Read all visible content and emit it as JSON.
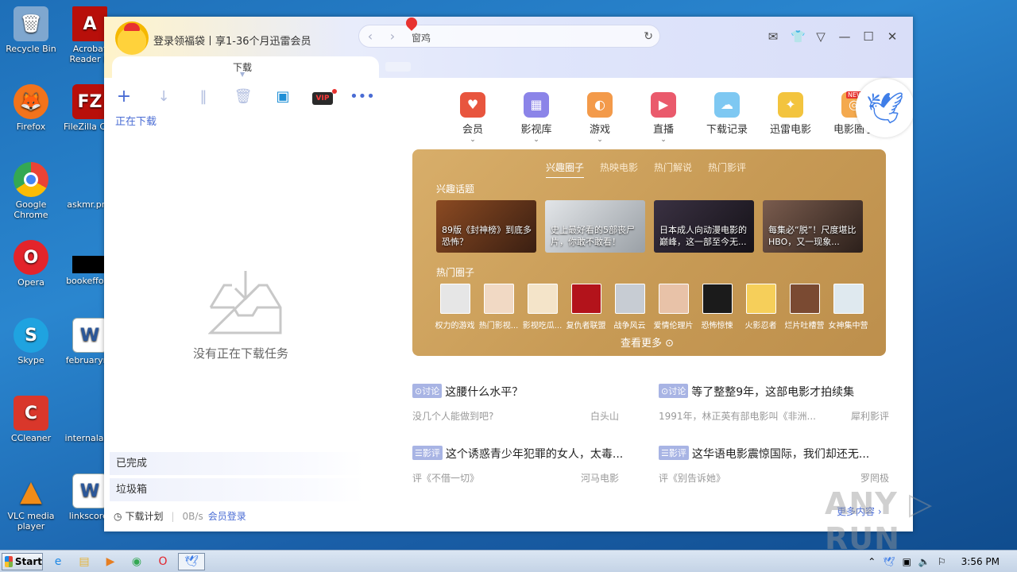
{
  "desktop": {
    "icons": [
      {
        "label": "Recycle Bin",
        "glyph": "🗑",
        "color": "#7fa7cf"
      },
      {
        "label": "Firefox",
        "glyph": "🦊",
        "color": "#f2731b"
      },
      {
        "label": "Google Chrome",
        "glyph": "◉",
        "color": "#34a853"
      },
      {
        "label": "Opera",
        "glyph": "O",
        "color": "#e3242b"
      },
      {
        "label": "Skype",
        "glyph": "S",
        "color": "#1fa3e0"
      },
      {
        "label": "CCleaner",
        "glyph": "C",
        "color": "#d9372b"
      },
      {
        "label": "VLC media player",
        "glyph": "▲",
        "color": "#f28c18"
      }
    ],
    "icons_col2": [
      {
        "label": "Acrobat Reader D",
        "glyph": "A",
        "color": "#b80f0a"
      },
      {
        "label": "FileZilla Clie",
        "glyph": "FZ",
        "color": "#b80f0a"
      },
      {
        "label": "askmr.png",
        "glyph": "",
        "color": "transparent"
      },
      {
        "label": "bookeffort.",
        "glyph": "",
        "color": "#000000"
      },
      {
        "label": "februaryna",
        "glyph": "W",
        "color": "#2b579a"
      },
      {
        "label": "internalang",
        "glyph": "",
        "color": "transparent"
      },
      {
        "label": "linkscore.",
        "glyph": "W",
        "color": "#2b579a"
      }
    ]
  },
  "taskbar": {
    "start_label": "Start",
    "clock": "3:56 PM"
  },
  "app": {
    "login_text": "登录领福袋丨享1-36个月迅雷会员",
    "url_text": "窗鸡",
    "tab_label": "下载",
    "downloading_label": "正在下载",
    "vip_label": "VIP",
    "empty_text": "没有正在下载任务",
    "side_completed": "已完成",
    "side_trash": "垃圾箱",
    "footer_plan": "下载计划",
    "footer_speed": "0B/s",
    "footer_member": "会员登录"
  },
  "categories": [
    {
      "label": "会员",
      "glyph": "♥",
      "color": "#e8553e",
      "caret": "⌄"
    },
    {
      "label": "影视库",
      "glyph": "▦",
      "color": "#8b84e8",
      "caret": "⌄"
    },
    {
      "label": "游戏",
      "glyph": "◐",
      "color": "#f39a4a",
      "caret": "⌄"
    },
    {
      "label": "直播",
      "glyph": "▶",
      "color": "#ea5a6c",
      "caret": "⌄"
    },
    {
      "label": "下载记录",
      "glyph": "☁",
      "color": "#7ec8f2",
      "caret": ""
    },
    {
      "label": "迅雷电影",
      "glyph": "✦",
      "color": "#f3c43e",
      "caret": ""
    },
    {
      "label": "电影圈子",
      "glyph": "◎",
      "color": "#f4a94e",
      "caret": ""
    }
  ],
  "new_tag": "NEW",
  "panel": {
    "tabs": [
      "兴趣圈子",
      "热映电影",
      "热门解说",
      "热门影评"
    ],
    "topics_heading": "兴趣话题",
    "topics": [
      {
        "caption": "89版《封神榜》到底多恐怖？",
        "bg": "#6b3a22"
      },
      {
        "caption": "史上最好看的5部丧尸片，你敢不敢看！",
        "bg": "#c9cdd2"
      },
      {
        "caption": "日本成人向动漫电影的巅峰，这一部至今无...",
        "bg": "#2a2430"
      },
      {
        "caption": "每集必“脱”！尺度堪比HBO，又一现象...",
        "bg": "#5a4136"
      }
    ],
    "circles_heading": "热门圈子",
    "circles": [
      {
        "label": "权力的游戏",
        "bg": "#e6e6e6"
      },
      {
        "label": "热门影视...",
        "bg": "#f1d9c4"
      },
      {
        "label": "影视吃瓜...",
        "bg": "#f4e4c9"
      },
      {
        "label": "复仇者联盟",
        "bg": "#b3131b"
      },
      {
        "label": "战争风云",
        "bg": "#c7ccd3"
      },
      {
        "label": "爱情伦理片",
        "bg": "#e8c2a8"
      },
      {
        "label": "恐怖惊悚",
        "bg": "#1b1b1b"
      },
      {
        "label": "火影忍者",
        "bg": "#f6cf5a"
      },
      {
        "label": "烂片吐槽营",
        "bg": "#7a4a32"
      },
      {
        "label": "女神集中营",
        "bg": "#dfe9ef"
      }
    ],
    "see_more": "查看更多 ⊙"
  },
  "news": [
    {
      "tag": "⊙讨论",
      "head": "这腰什么水平？",
      "sub": "没几个人能做到吧?",
      "author": "白头山"
    },
    {
      "tag": "⊙讨论",
      "head": "等了整整9年，这部电影才拍续集",
      "sub": "1991年，林正英有部电影叫《非洲...",
      "author": "犀利影评"
    },
    {
      "tag": "☰影评",
      "head": "这个诱惑青少年犯罪的女人，太毒...",
      "sub": "评《不借一切》",
      "author": "河马电影"
    },
    {
      "tag": "☰影评",
      "head": "这华语电影震惊国际，我们却还无...",
      "sub": "评《别告诉她》",
      "author": "罗罔极"
    }
  ],
  "more_content": "更多内容 ›",
  "watermark": "ANY ▷ RUN"
}
